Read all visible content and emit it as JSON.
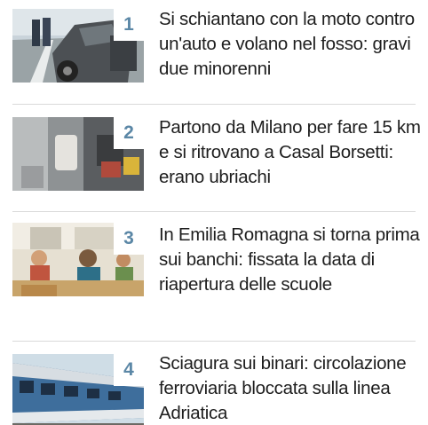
{
  "articles": [
    {
      "rank": "1",
      "title": "Si schiantano con la moto contro un'auto e volano nel fosso: gravi due minorenni",
      "image": "crash-scene-photo"
    },
    {
      "rank": "2",
      "title": "Partono da Milano per fare 15 km e si ritrovano a Casal Borsetti: erano ubriachi",
      "image": "car-interior-photo"
    },
    {
      "rank": "3",
      "title": "In Emilia Romagna si torna prima sui banchi: fissata la data di riapertura delle scuole",
      "image": "classroom-photo"
    },
    {
      "rank": "4",
      "title": "Sciagura sui binari: circolazione ferroviaria bloccata sulla linea Adriatica",
      "image": "train-photo"
    }
  ],
  "colors": {
    "rank": "#5b87a6",
    "separator": "#d9d9d9",
    "text": "#1e1e1e"
  }
}
